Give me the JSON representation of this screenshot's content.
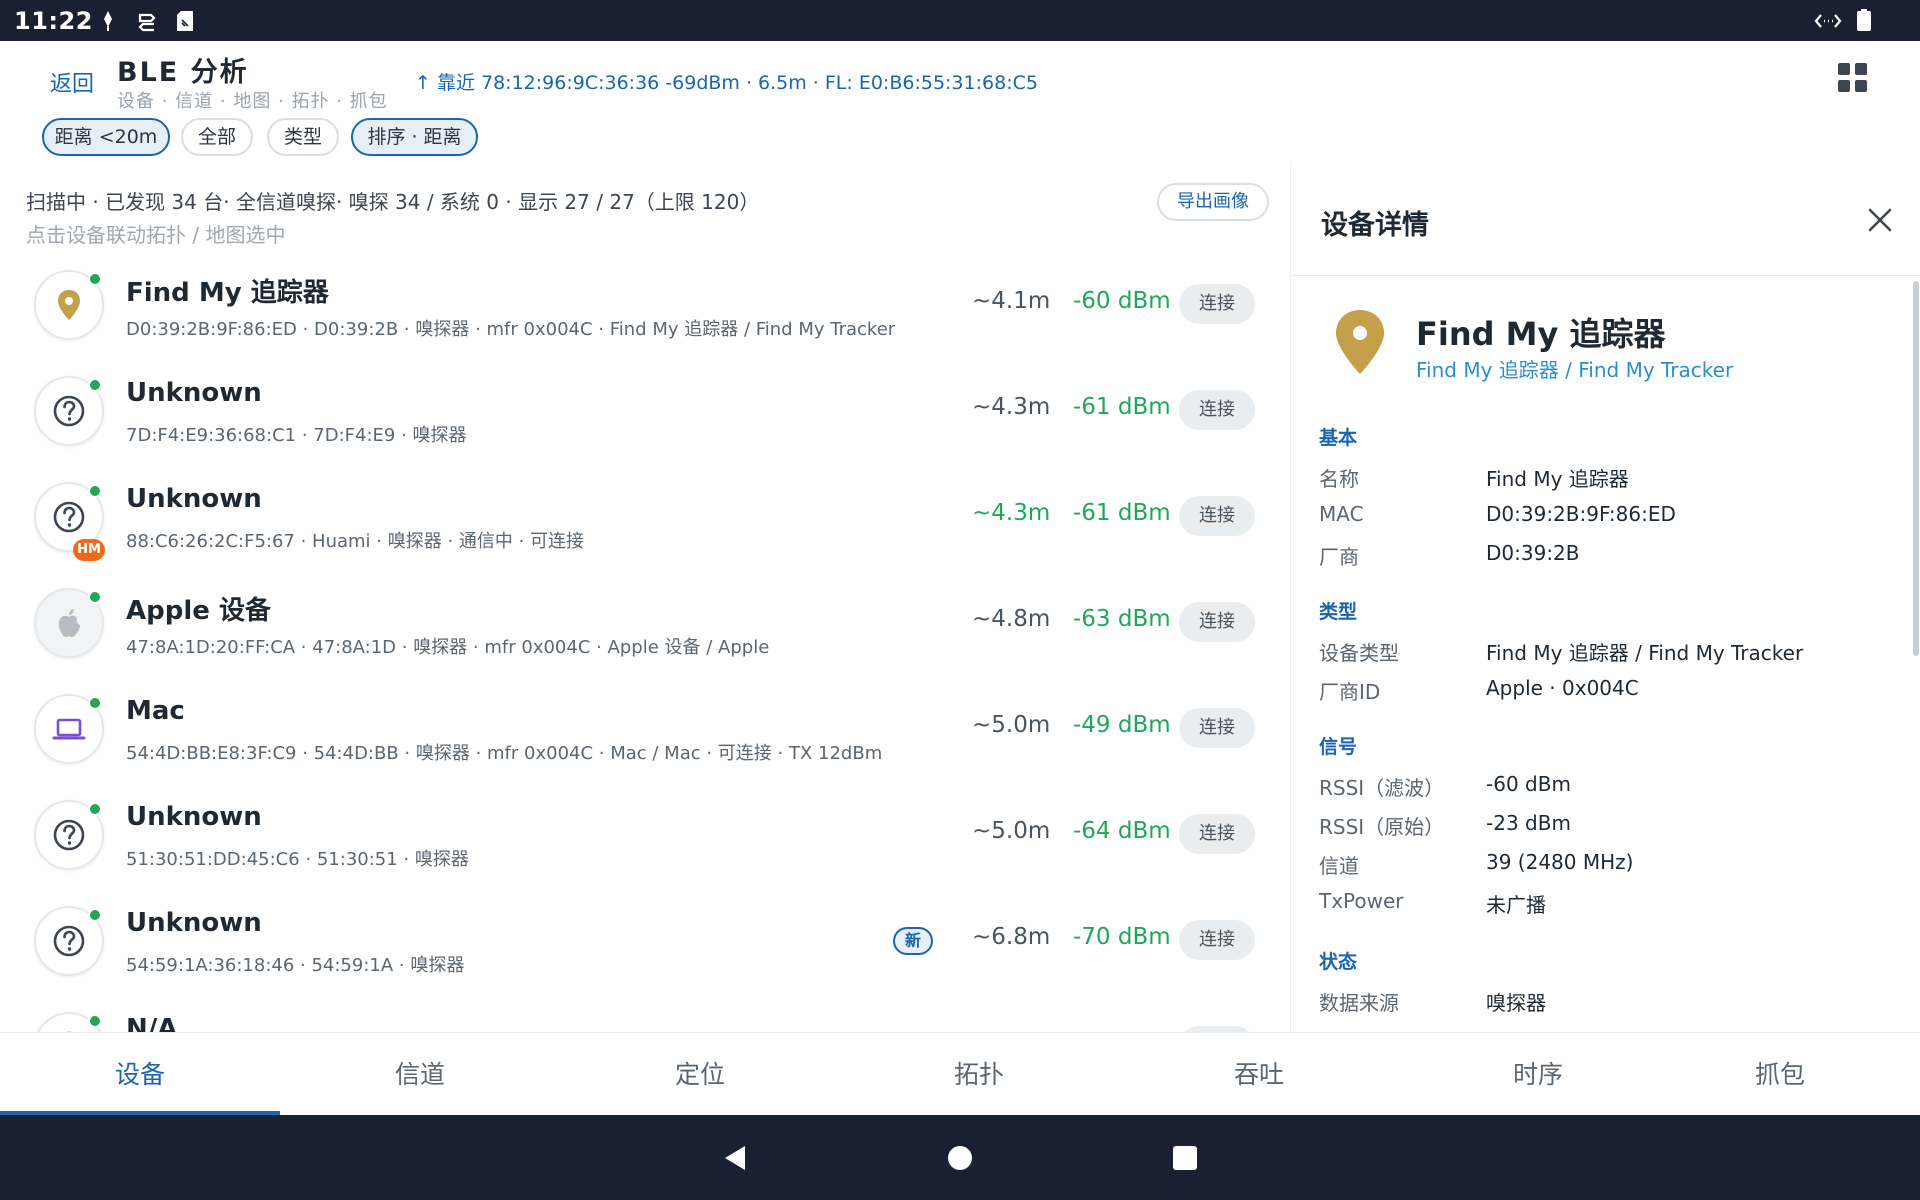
{
  "status_bar": {
    "time": "11:22"
  },
  "header": {
    "back_label": "返回",
    "title": "BLE 分析",
    "subtitle": "设备 · 信道 · 地图 · 拓扑 · 抓包",
    "nearest": "↑ 靠近 78:12:96:9C:36:36 -69dBm · 6.5m  ·  FL: E0:B6:55:31:68:C5"
  },
  "chips": [
    {
      "label": "距离 <20m",
      "active": true
    },
    {
      "label": "全部",
      "active": false
    },
    {
      "label": "类型",
      "active": false
    },
    {
      "label": "排序 · 距离",
      "active": true
    }
  ],
  "scan": {
    "status": "扫描中 · 已发现 34 台· 全信道嗅探· 嗅探 34 / 系统 0 · 显示 27 / 27（上限 120）",
    "hint": "点击设备联动拓扑 / 地图选中",
    "export_label": "导出画像"
  },
  "devices": [
    {
      "name": "Find My 追踪器",
      "meta": "D0:39:2B:9F:86:ED · D0:39:2B · 嗅探器 · mfr 0x004C · Find My 追踪器 / Find My Tracker",
      "distance": "~4.1m",
      "rssi": "-60 dBm",
      "connect": "连接",
      "icon": "location-pin-icon"
    },
    {
      "name": "Unknown",
      "meta": "7D:F4:E9:36:68:C1 · 7D:F4:E9 · 嗅探器",
      "distance": "~4.3m",
      "rssi": "-61 dBm",
      "connect": "连接",
      "icon": "question-icon"
    },
    {
      "name": "Unknown",
      "meta": "88:C6:26:2C:F5:67 · Huami · 嗅探器 · 通信中 · 可连接",
      "distance": "~4.3m",
      "rssi": "-61 dBm",
      "connect": "连接",
      "icon": "question-icon",
      "badge": "HM"
    },
    {
      "name": "Apple 设备",
      "meta": "47:8A:1D:20:FF:CA · 47:8A:1D · 嗅探器 · mfr 0x004C · Apple 设备 / Apple",
      "distance": "~4.8m",
      "rssi": "-63 dBm",
      "connect": "连接",
      "icon": "apple-icon"
    },
    {
      "name": "Mac",
      "meta": "54:4D:BB:E8:3F:C9 · 54:4D:BB · 嗅探器 · mfr 0x004C · Mac / Mac · 可连接 · TX 12dBm",
      "distance": "~5.0m",
      "rssi": "-49 dBm",
      "connect": "连接",
      "icon": "laptop-icon"
    },
    {
      "name": "Unknown",
      "meta": "51:30:51:DD:45:C6 · 51:30:51 · 嗅探器",
      "distance": "~5.0m",
      "rssi": "-64 dBm",
      "connect": "连接",
      "icon": "question-icon"
    },
    {
      "name": "Unknown",
      "meta": "54:59:1A:36:18:46 · 54:59:1A · 嗅探器",
      "distance": "~6.8m",
      "rssi": "-70 dBm",
      "connect": "连接",
      "icon": "question-icon",
      "new_label": "新"
    },
    {
      "name": "N/A",
      "meta": "",
      "distance": "",
      "rssi": "",
      "connect": "",
      "icon": "question-icon"
    }
  ],
  "detail": {
    "title": "设备详情",
    "name": "Find My 追踪器",
    "subtitle": "Find My 追踪器 / Find My Tracker",
    "sections": {
      "basic": "基本",
      "type": "类型",
      "signal": "信号",
      "status": "状态"
    },
    "rows": {
      "name_k": "名称",
      "name_v": "Find My 追踪器",
      "mac_k": "MAC",
      "mac_v": "D0:39:2B:9F:86:ED",
      "vendor_k": "厂商",
      "vendor_v": "D0:39:2B",
      "devtype_k": "设备类型",
      "devtype_v": "Find My 追踪器 / Find My Tracker",
      "vendorid_k": "厂商ID",
      "vendorid_v": "Apple · 0x004C",
      "rssi_f_k": "RSSI（滤波）",
      "rssi_f_v": "-60 dBm",
      "rssi_r_k": "RSSI（原始）",
      "rssi_r_v": "-23 dBm",
      "channel_k": "信道",
      "channel_v": "39 (2480 MHz)",
      "tx_k": "TxPower",
      "tx_v": "未广播",
      "source_k": "数据来源",
      "source_v": "嗅探器"
    }
  },
  "tabs": [
    {
      "label": "设备",
      "active": true
    },
    {
      "label": "信道"
    },
    {
      "label": "定位"
    },
    {
      "label": "拓扑"
    },
    {
      "label": "吞吐"
    },
    {
      "label": "时序"
    },
    {
      "label": "抓包"
    }
  ],
  "colors": {
    "accent": "#1a64b0",
    "signal_green": "#22a65a",
    "status_bar": "#182032",
    "badge_orange": "#ee6a1a"
  }
}
